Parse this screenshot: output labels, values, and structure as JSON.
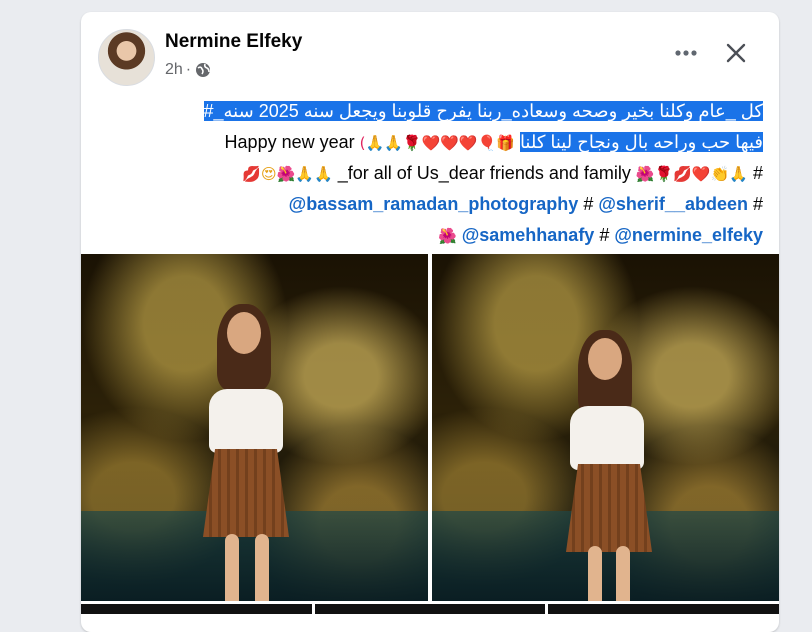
{
  "post": {
    "author": "Nermine Elfeky",
    "time": "2h",
    "dot": "·",
    "line1": "#_كل _عام وكلنا بخير وصحه وسعاده_ربنا يفرح قلوبنا ويجعل سنه 2025  سنه",
    "line2_highlight": "فيها حب وراحه بال ونجاح لينا كلنا",
    "line2_emojis": "(🙏🙏🌹❤️❤️❤️🎈🎁",
    "line2_text": "Happy new year",
    "line3_start": "#",
    "line3_emojis_a": "🌺🌹💋❤️👏🙏",
    "line3_text": "_for all of Us_dear friends and family",
    "line3_emojis_b": "💋😍🌺🙏🙏",
    "line4_hash1": "#",
    "mention1": "@sherif__abdeen",
    "line4_hash2": "#",
    "mention2": "@bassam_ramadan_photography",
    "mention3": "@nermine_elfeky",
    "line5_hash": "#",
    "mention4": "@samehhanafy",
    "line5_emoji": "🌺"
  },
  "icons": {
    "more": "more-icon",
    "close": "close-icon",
    "globe": "globe-icon"
  },
  "colors": {
    "accent": "#1666c5",
    "highlight": "#1a73e8",
    "meta": "#65676b"
  }
}
